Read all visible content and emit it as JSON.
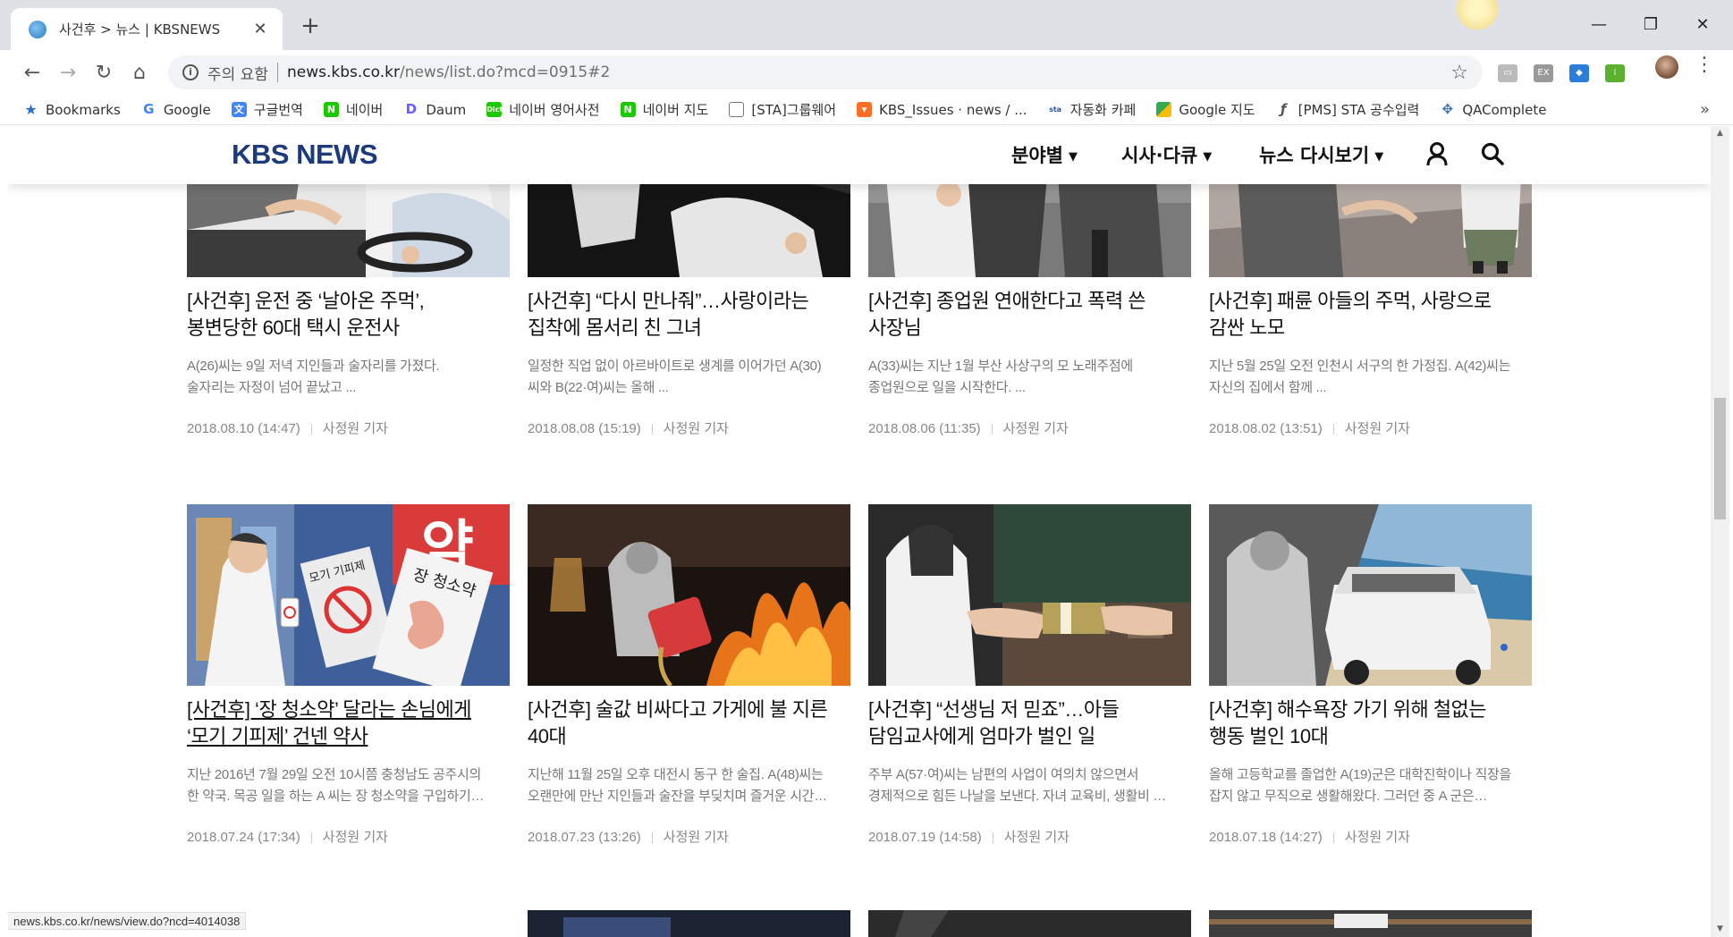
{
  "browser": {
    "tab_title": "사건후 > 뉴스 | KBSNEWS",
    "security_text": "주의 요함",
    "url_host": "news.kbs.co.kr",
    "url_path": "/news/list.do?mcd=0915#2",
    "bookmarks": [
      {
        "label": "Bookmarks",
        "icon": "star-icon"
      },
      {
        "label": "Google",
        "icon": "google-icon"
      },
      {
        "label": "구글번역",
        "icon": "translate-icon"
      },
      {
        "label": "네이버",
        "icon": "naver-icon"
      },
      {
        "label": "Daum",
        "icon": "daum-icon"
      },
      {
        "label": "네이버 영어사전",
        "icon": "dict-icon"
      },
      {
        "label": "네이버 지도",
        "icon": "naver-icon"
      },
      {
        "label": "[STA]그룹웨어",
        "icon": "page-icon"
      },
      {
        "label": "KBS_Issues · news / ...",
        "icon": "gitlab-icon"
      },
      {
        "label": "자동화 카페",
        "icon": "cafe-icon"
      },
      {
        "label": "Google 지도",
        "icon": "maps-icon"
      },
      {
        "label": "[PMS] STA 공수입력",
        "icon": "pms-icon"
      },
      {
        "label": "QAComplete",
        "icon": "qa-icon"
      }
    ],
    "status_url": "news.kbs.co.kr/news/view.do?ncd=4014038"
  },
  "site": {
    "logo": "KBS NEWS",
    "nav": [
      "분야별",
      "시사·다큐",
      "뉴스 다시보기"
    ]
  },
  "articles": [
    {
      "title_line1": "[사건후] 운전 중 ‘날아온 주먹’,",
      "title_line2": "봉변당한 60대 택시 운전사",
      "desc_line1": "A(26)씨는 9일 저녁 지인들과 술자리를 가졌다.",
      "desc_line2": "술자리는 자정이 넘어 끝났고 ...",
      "date": "2018.08.10 (14:47)",
      "author": "사정원 기자"
    },
    {
      "title_line1": "[사건후] “다시 만나줘”…사랑이라는",
      "title_line2": "집착에 몸서리 친 그녀",
      "desc_line1": "일정한 직업 없이 아르바이트로 생계를 이어가던 A(30)",
      "desc_line2": "씨와 B(22·여)씨는 올해 ...",
      "date": "2018.08.08 (15:19)",
      "author": "사정원 기자"
    },
    {
      "title_line1": "[사건후] 종업원 연애한다고 폭력 쓴",
      "title_line2": "사장님",
      "desc_line1": "A(33)씨는 지난 1월 부산 사상구의 모 노래주점에",
      "desc_line2": "종업원으로 일을 시작한다. ...",
      "date": "2018.08.06 (11:35)",
      "author": "사정원 기자"
    },
    {
      "title_line1": "[사건후] 패륜 아들의 주먹, 사랑으로",
      "title_line2": "감싼 노모",
      "desc_line1": "지난 5월 25일 오전 인천시 서구의 한 가정집. A(42)씨는",
      "desc_line2": "자신의 집에서 함께 ...",
      "date": "2018.08.02 (13:51)",
      "author": "사정원 기자"
    },
    {
      "title_line1": "[사건후] ‘장 청소약’ 달라는 손님에게",
      "title_line2": "‘모기 기피제’ 건넨 약사",
      "desc_line1": "지난 2016년 7월 29일 오전 10시쯤 충청남도 공주시의",
      "desc_line2": "한 약국. 목공 일을 하는 A 씨는 장 청소약을 구입하기…",
      "date": "2018.07.24 (17:34)",
      "author": "사정원 기자",
      "thumb_labels": [
        "약",
        "모기 기피제",
        "장 청소약"
      ]
    },
    {
      "title_line1": "[사건후] 술값 비싸다고 가게에 불 지른",
      "title_line2": "40대",
      "desc_line1": "지난해 11월 25일 오후 대전시 동구 한 술집. A(48)씨는",
      "desc_line2": "오랜만에 만난 지인들과 술잔을 부딪치며 즐거운 시간…",
      "date": "2018.07.23 (13:26)",
      "author": "사정원 기자"
    },
    {
      "title_line1": "[사건후] “선생님 저 믿죠”…아들",
      "title_line2": "담임교사에게 엄마가 벌인 일",
      "desc_line1": "주부 A(57·여)씨는 남편의 사업이 여의치 않으면서",
      "desc_line2": "경제적으로 힘든 나날을 보낸다. 자녀 교육비, 생활비 …",
      "date": "2018.07.19 (14:58)",
      "author": "사정원 기자"
    },
    {
      "title_line1": "[사건후] 해수욕장 가기 위해 철없는",
      "title_line2": "행동 벌인 10대",
      "desc_line1": "올해 고등학교를 졸업한 A(19)군은 대학진학이나 직장을",
      "desc_line2": "잡지 않고 무직으로 생활해왔다. 그러던 중 A 군은…",
      "date": "2018.07.18 (14:27)",
      "author": "사정원 기자"
    }
  ]
}
